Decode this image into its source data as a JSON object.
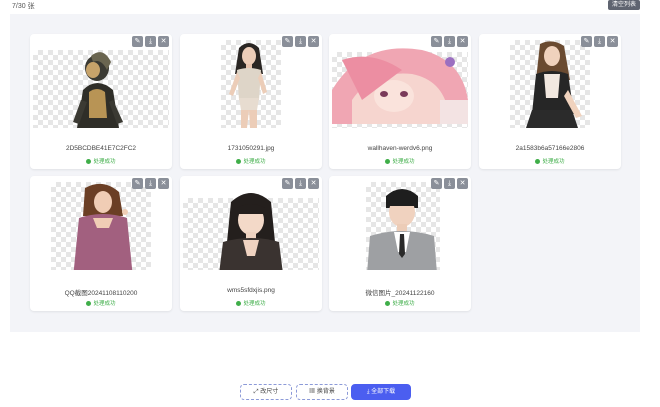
{
  "header": {
    "count": "7/30 张",
    "clear_label": "清空列表"
  },
  "tool_icons": [
    "edit-icon",
    "download-icon",
    "close-icon"
  ],
  "status_color": "#3fae49",
  "accent": "#4b5ef0",
  "cards": [
    {
      "filename": "2D5BCDBE41E7C2FC2",
      "status": "处理成功"
    },
    {
      "filename": "1731050291.jpg",
      "status": "处理成功"
    },
    {
      "filename": "wallhaven-werdv6.png",
      "status": "处理成功"
    },
    {
      "filename": "2a1583b6a57166e2806",
      "status": "处理成功"
    },
    {
      "filename": "QQ截图20241108110200",
      "status": "处理成功"
    },
    {
      "filename": "wms5sfdxjis.png",
      "status": "处理成功"
    },
    {
      "filename": "微信图片_20241122160",
      "status": "处理成功"
    }
  ],
  "footer": {
    "size_label": "改尺寸",
    "bg_label": "换背景",
    "download_label": "全部下载"
  }
}
